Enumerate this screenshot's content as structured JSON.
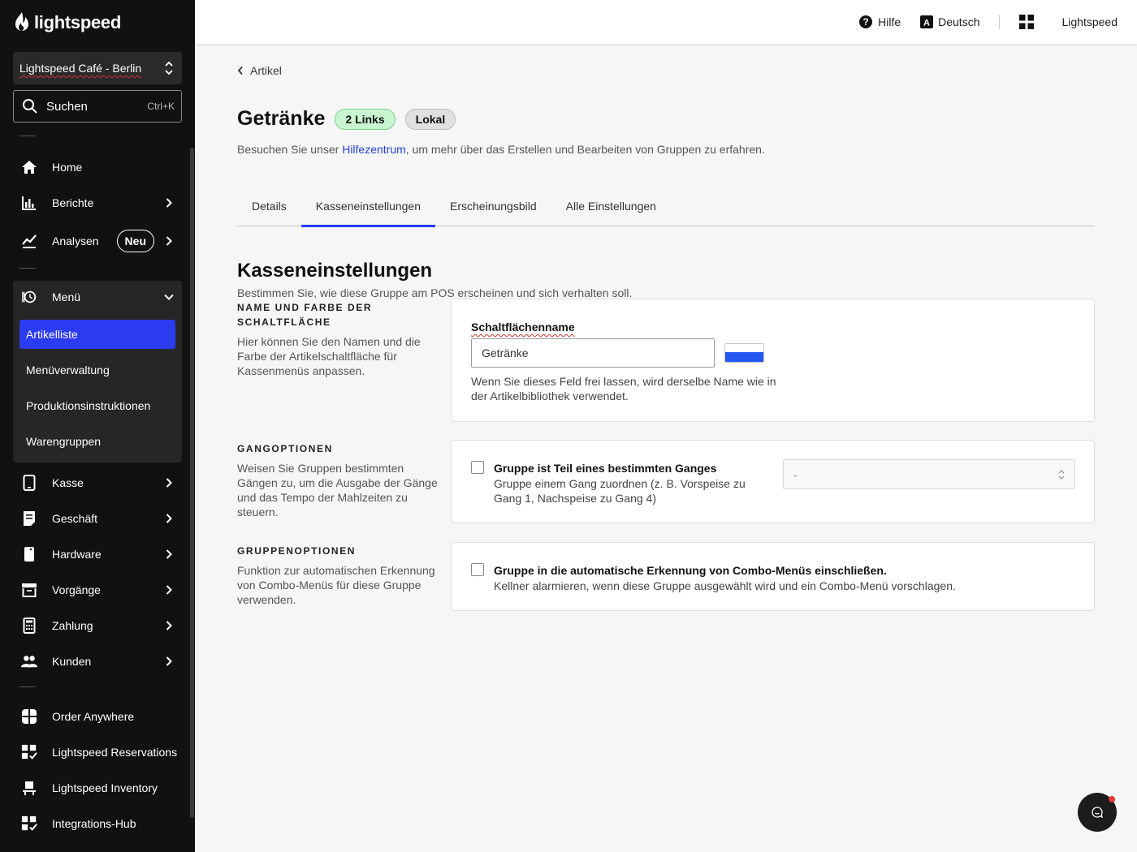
{
  "brand": {
    "name": "lightspeed"
  },
  "sidebar": {
    "venue": "Lightspeed Café - Berlin",
    "search": {
      "label": "Suchen",
      "shortcut": "Ctrl+K"
    },
    "items": [
      {
        "label": "Home",
        "icon": "home-icon"
      },
      {
        "label": "Berichte",
        "icon": "bar-chart-icon"
      },
      {
        "label": "Analysen",
        "icon": "trend-icon",
        "badge": "Neu"
      },
      {
        "label": "Menü",
        "icon": "menu-book-icon"
      },
      {
        "label": "Kasse",
        "icon": "tablet-icon"
      },
      {
        "label": "Geschäft",
        "icon": "receipt-icon"
      },
      {
        "label": "Hardware",
        "icon": "device-icon"
      },
      {
        "label": "Vorgänge",
        "icon": "archive-icon"
      },
      {
        "label": "Zahlung",
        "icon": "calculator-icon"
      },
      {
        "label": "Kunden",
        "icon": "users-icon"
      },
      {
        "label": "Order Anywhere",
        "icon": "order-anywhere-icon"
      },
      {
        "label": "Lightspeed Reservations",
        "icon": "reservations-icon"
      },
      {
        "label": "Lightspeed Inventory",
        "icon": "inventory-icon"
      },
      {
        "label": "Integrations-Hub",
        "icon": "integrations-icon"
      }
    ],
    "menu_sub": [
      "Artikelliste",
      "Menüverwaltung",
      "Produktionsinstruktionen",
      "Warengruppen"
    ],
    "active_sub": "Artikelliste"
  },
  "topbar": {
    "help": "Hilfe",
    "language": "Deutsch",
    "account": "Lightspeed"
  },
  "page": {
    "back": "Artikel",
    "title": "Getränke",
    "badges": [
      "2 Links",
      "Lokal"
    ],
    "help_prefix": "Besuchen Sie unser ",
    "help_link": "Hilfezentrum",
    "help_suffix": ", um mehr über das Erstellen und Bearbeiten von Gruppen zu erfahren.",
    "tabs": [
      "Details",
      "Kasseneinstellungen",
      "Erscheinungsbild",
      "Alle Einstellungen"
    ],
    "active_tab": "Kasseneinstellungen"
  },
  "settings": {
    "title": "Kasseneinstellungen",
    "description": "Bestimmen Sie, wie diese Gruppe am POS erscheinen und sich verhalten soll.",
    "button_block": {
      "heading": "NAME UND FARBE DER SCHALTFLÄCHE",
      "description": "Hier können Sie den Namen und die Farbe der Artikelschaltfläche für Kassenmenüs anpassen.",
      "field_label": "Schaltflächenname",
      "field_value": "Getränke",
      "hint": "Wenn Sie dieses Feld frei lassen, wird derselbe Name wie in der Artikelbibliothek verwendet.",
      "color": "#2457f0"
    },
    "course_block": {
      "heading": "GANGOPTIONEN",
      "description": "Weisen Sie Gruppen bestimmten Gängen zu, um die Ausgabe der Gänge und das Tempo der Mahlzeiten zu steuern.",
      "checkbox_title": "Gruppe ist Teil eines bestimmten Ganges",
      "checkbox_desc": "Gruppe einem Gang zuordnen (z. B. Vorspeise zu Gang 1, Nachspeise zu Gang 4)",
      "select_value": "-"
    },
    "group_block": {
      "heading": "GRUPPENOPTIONEN",
      "description": "Funktion zur automatischen Erkennung von Combo-Menüs für diese Gruppe verwenden.",
      "checkbox_title": "Gruppe in die automatische Erkennung von Combo-Menüs einschließen.",
      "checkbox_desc": "Kellner alarmieren, wenn diese Gruppe ausgewählt wird und ein Combo-Menü vorschlagen."
    }
  },
  "colors": {
    "accent": "#2b3bf0",
    "sidebar_bg": "#111111",
    "link": "#2441d6",
    "badge_green": "#c8f5cf"
  }
}
